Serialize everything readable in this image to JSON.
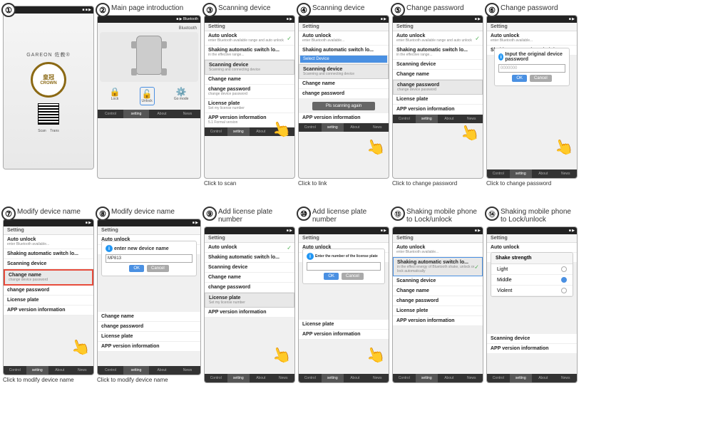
{
  "steps": {
    "top": [
      {
        "number": "1",
        "title": "",
        "screen_type": "crown_logo",
        "caption": ""
      },
      {
        "number": "2",
        "title": "Main page introduction",
        "screen_type": "main_page",
        "caption": ""
      },
      {
        "number": "3",
        "title": "Scanning device",
        "screen_type": "scanning_click",
        "caption": "Click to scan"
      },
      {
        "number": "4",
        "title": "Scanning device",
        "screen_type": "scanning_link",
        "caption": "Click to link"
      },
      {
        "number": "5",
        "title": "Change password",
        "screen_type": "change_password_click",
        "caption": "Click to change password"
      },
      {
        "number": "6",
        "title": "Change password",
        "screen_type": "change_password_input",
        "caption": "Click to change password"
      }
    ],
    "bottom": [
      {
        "number": "7",
        "title": "Modify device name",
        "screen_type": "modify_name_click",
        "caption": "Click to modify device name"
      },
      {
        "number": "8",
        "title": "Modify device name",
        "screen_type": "modify_name_input",
        "caption": "Click to modify device name"
      },
      {
        "number": "9",
        "title": "Add license plate number",
        "screen_type": "license_click",
        "caption": ""
      },
      {
        "number": "10",
        "title": "Add license plate number",
        "screen_type": "license_input",
        "caption": ""
      },
      {
        "number": "13",
        "title": "Shaking mobile phone to Lock/unlock",
        "screen_type": "shake_click",
        "caption": ""
      },
      {
        "number": "14",
        "title": "Shaking mobile phone to Lock/unlock",
        "screen_type": "shake_options",
        "caption": ""
      }
    ]
  },
  "menu_items": [
    {
      "title": "Auto unlock",
      "sub": "enter Bluetooth available range and auto unlock"
    },
    {
      "title": "Shaking automatic switch lo...",
      "sub": "in the effective range of Bluetooth, shake, unlock or lock auto bluetooth"
    },
    {
      "title": "Scanning device",
      "sub": "Scanning and connecting device"
    },
    {
      "title": "Change name",
      "sub": "change device password"
    },
    {
      "title": "change password",
      "sub": "change device password"
    },
    {
      "title": "License plate",
      "sub": "Set my license number"
    },
    {
      "title": "APP version information",
      "sub": "5.1 Formal version"
    }
  ],
  "tabs": [
    "Control",
    "setting",
    "About",
    "News"
  ],
  "active_tab": "setting",
  "dialog": {
    "password_title": "Input the original device password",
    "password_placeholder": "0000000",
    "name_title": "enter new device name",
    "name_value": "MP813",
    "license_title": "Enter the number of the license plate",
    "ok": "OK",
    "cancel": "Cancel"
  },
  "shake_options": [
    {
      "label": "Light",
      "selected": false
    },
    {
      "label": "Middle",
      "selected": true
    },
    {
      "label": "Violent",
      "selected": false
    }
  ],
  "shake_title": "Shake strength",
  "crown_brand": "GAREON 佐教®",
  "crown_name": "CROWN"
}
